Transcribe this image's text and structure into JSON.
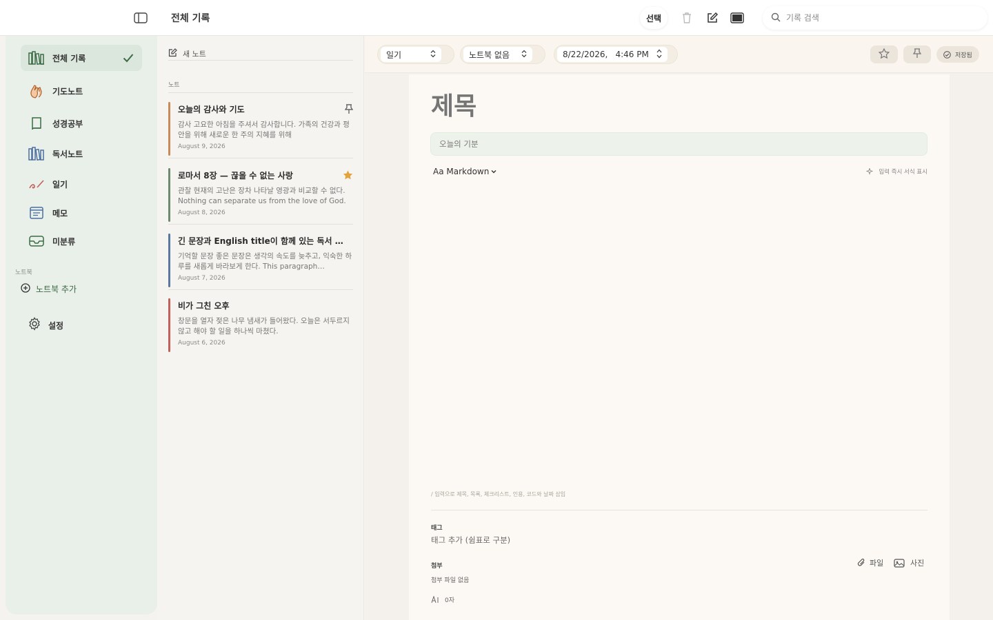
{
  "header": {
    "title": "전체 기록",
    "select_label": "선택",
    "search_placeholder": "기록 검색"
  },
  "sidebar": {
    "items": [
      {
        "label": "전체 기록",
        "icon": "bookshelf-icon",
        "active": true
      },
      {
        "label": "기도노트",
        "icon": "praying-hands-icon"
      },
      {
        "label": "성경공부",
        "icon": "book-icon"
      },
      {
        "label": "독서노트",
        "icon": "bookshelf-icon"
      },
      {
        "label": "일기",
        "icon": "pen-icon"
      },
      {
        "label": "메모",
        "icon": "memo-icon"
      },
      {
        "label": "미분류",
        "icon": "inbox-icon"
      }
    ],
    "notebook_section": "노트북",
    "add_notebook": "노트북 추가",
    "settings": "설정"
  },
  "list": {
    "new_note": "새 노트",
    "section": "노트",
    "notes": [
      {
        "title": "오늘의 감사와 기도",
        "preview": "감사 고요한 아침을 주셔서 감사합니다. 가족의 건강과 평안을 위해 새로운 한 주의 지혜를 위해",
        "date": "August 9, 2026",
        "color": "#c98a5a",
        "mark": "pin"
      },
      {
        "title": "로마서 8장 — 끊을 수 없는 사랑",
        "preview": "관찰 현재의 고난은 장차 나타날 영광과 비교할 수 없다. Nothing can separate us from the love of God.",
        "date": "August 8, 2026",
        "color": "#6f8a6f",
        "mark": "star"
      },
      {
        "title": "긴 문장과 English title이 함께 있는 독서 기록",
        "preview": "기억할 문장 좋은 문장은 생각의 속도를 늦추고, 익숙한 하루를 새롭게 바라보게 한다. This paragraph continues.",
        "date": "August 7, 2026",
        "color": "#5a78a0",
        "mark": ""
      },
      {
        "title": "비가 그친 오후",
        "preview": "창문을 열자 젖은 나무 냄새가 들어왔다. 오늘은 서두르지 않고 해야 할 일을 하나씩 마쳤다.",
        "date": "August 6, 2026",
        "color": "#c4605a",
        "mark": ""
      }
    ]
  },
  "editor": {
    "type_value": "일기",
    "notebook_value": "노트북 없음",
    "date_value": "8/22/2026,",
    "time_value": "4:46 PM",
    "saved_label": "저장됨",
    "title_placeholder": "제목",
    "mood_placeholder": "오늘의 기분",
    "format_label": "Aa Markdown",
    "live_label": "입력 즉시 서식 표시",
    "hint": "/ 입력으로 제목, 목록, 체크리스트, 인용, 코드와 날짜 삽입",
    "tag_label": "태그",
    "tag_placeholder": "태그 추가 (쉼표로 구분)",
    "attach_label": "첨부",
    "attach_none": "첨부 파일 없음",
    "file_label": "파일",
    "photo_label": "사진",
    "char_count": "0자"
  },
  "colors": {
    "accent_green": "#3b6b45",
    "star": "#e2a33b",
    "sidebar_bg": "#e9efe9"
  }
}
